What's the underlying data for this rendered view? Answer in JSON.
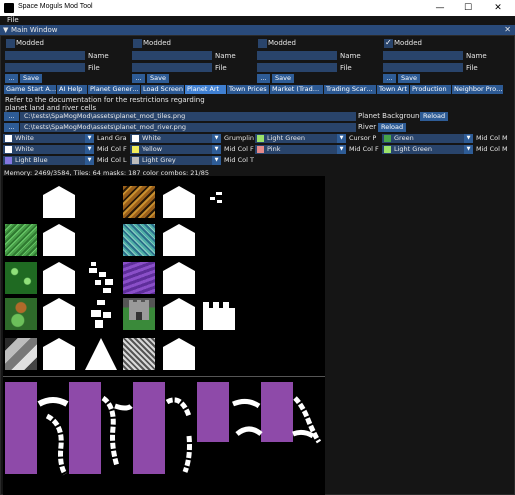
{
  "window": {
    "title": "Space Moguls Mod Tool",
    "minimize": "—",
    "maximize": "☐",
    "close": "✕"
  },
  "menu": {
    "file": "File"
  },
  "main_window": {
    "title": "Main Window",
    "collapse_icon": "▼",
    "close_icon": "✕"
  },
  "mod_slots": [
    {
      "modded_label": "Modded",
      "checked": false,
      "name_label": "Name",
      "file_label": "File",
      "browse": "...",
      "save": "Save"
    },
    {
      "modded_label": "Modded",
      "checked": false,
      "name_label": "Name",
      "file_label": "File",
      "browse": "...",
      "save": "Save"
    },
    {
      "modded_label": "Modded",
      "checked": false,
      "name_label": "Name",
      "file_label": "File",
      "browse": "...",
      "save": "Save"
    },
    {
      "modded_label": "Modded",
      "checked": true,
      "name_label": "Name",
      "file_label": "File",
      "browse": "...",
      "save": "Save"
    }
  ],
  "tabs": [
    "Game Start A…",
    "AI Help",
    "Planet Gener…",
    "Load Screen",
    "Planet Art",
    "Town Prices",
    "Market (Trad…",
    "Trading Scar…",
    "Town Art",
    "Production",
    "Neighbor Pro…"
  ],
  "selected_tab": "Planet Art",
  "doc_note": "Refer to the documentation for the restrictions regarding\nplanet land and river cells",
  "files": [
    {
      "browse": "...",
      "path": "C:\\tests\\SpaMogMod\\assets\\planet_mod_tiles.png",
      "label": "Planet Background",
      "reload": "Reload"
    },
    {
      "browse": "...",
      "path": "C:\\tests\\SpaMogMod\\assets\\planet_mod_river.png",
      "label": "River",
      "reload": "Reload"
    }
  ],
  "color_rows": [
    [
      {
        "swatch": "#ffffff",
        "value": "White",
        "label": "Land Gra"
      },
      {
        "swatch": "#ffffff",
        "value": "White",
        "label": "Grumplin"
      },
      {
        "swatch": "#9be36a",
        "value": "Light Green",
        "label": "Cursor P"
      },
      {
        "swatch": "#46a34a",
        "value": "Green",
        "label": "Mid Col M"
      }
    ],
    [
      {
        "swatch": "#ffffff",
        "value": "White",
        "label": "Mid Col F"
      },
      {
        "swatch": "#f0ec5a",
        "value": "Yellow",
        "label": "Mid Col F"
      },
      {
        "swatch": "#e68a8a",
        "value": "Pink",
        "label": "Mid Col F"
      },
      {
        "swatch": "#9be36a",
        "value": "Light Green",
        "label": "Mid Col M"
      }
    ],
    [
      {
        "swatch": "#8476e0",
        "value": "Light Blue",
        "label": "Mid Col L"
      },
      {
        "swatch": "#bcbcbc",
        "value": "Light Grey",
        "label": "Mid Col T"
      }
    ]
  ],
  "combo_arrow": "▼",
  "status": "Memory: 2469/3584, Tiles: 64 masks: 187 color combos: 21/85"
}
